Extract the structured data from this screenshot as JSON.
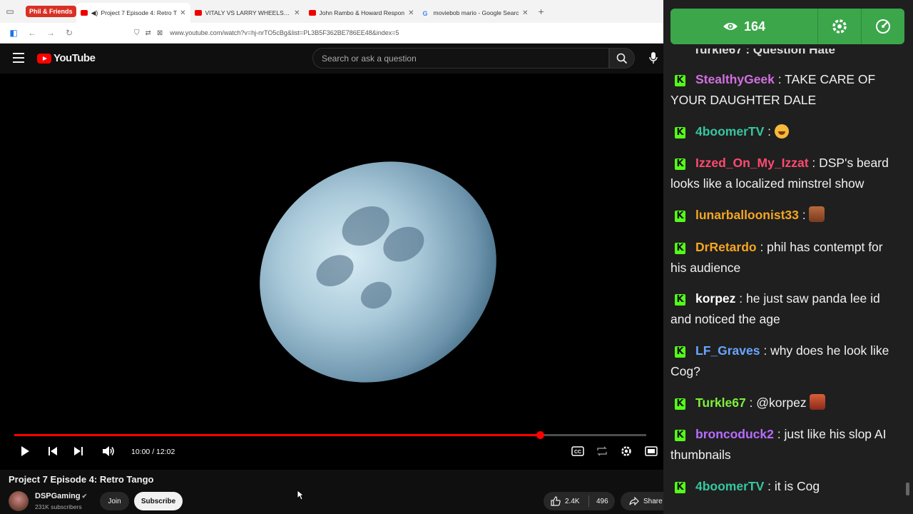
{
  "browser": {
    "tab_group": "Phil & Friends",
    "tabs": [
      {
        "title": "Project 7 Episode 4: Retro T",
        "active": true,
        "audio": true
      },
      {
        "title": "VITALY VS LARRY WHEELS (FULL"
      },
      {
        "title": "John Rambo & Howard Respon"
      },
      {
        "title": "moviebob mario - Google Searc"
      }
    ],
    "url": "www.youtube.com/watch?v=hj-nrTO5cBg&list=PL3B5F362BE786EE48&index=5"
  },
  "youtube": {
    "logo_text": "YouTube",
    "search_placeholder": "Search or ask a question",
    "player": {
      "time": "10:00 / 12:02",
      "progress": 0.8315
    },
    "video_title": "Project 7 Episode 4: Retro Tango",
    "channel": {
      "name": "DSPGaming",
      "subscribers": "231K subscribers",
      "join_label": "Join",
      "subscribe_label": "Subscribe"
    },
    "likes": "2.4K",
    "dislike_count": "496",
    "share_label": "Share"
  },
  "chat": {
    "viewer_count": "164",
    "partial_top": "Turkle67 : Question Hate",
    "messages": [
      {
        "user": "StealthyGeek",
        "color": "#d070e0",
        "text": "TAKE CARE OF YOUR DAUGHTER DALE"
      },
      {
        "user": "4boomerTV",
        "color": "#35c7a0",
        "text": "",
        "emote": "grin-emoji"
      },
      {
        "user": "Izzed_On_My_Izzat",
        "color": "#ff4a6e",
        "text": "DSP's beard looks like a localized minstrel show"
      },
      {
        "user": "lunarballoonist33",
        "color": "#f5a623",
        "text": "",
        "emote": "face-emote"
      },
      {
        "user": "DrRetardo",
        "color": "#f5a623",
        "text": "phil has contempt for his audience"
      },
      {
        "user": "korpez",
        "color": "#ffffff",
        "text": "he just saw panda lee id and noticed the age"
      },
      {
        "user": "LF_Graves",
        "color": "#6aa6ff",
        "text": "why does he look like Cog?"
      },
      {
        "user": "Turkle67",
        "color": "#7ef03a",
        "text": "@korpez",
        "emote": "face-emote"
      },
      {
        "user": "broncoduck2",
        "color": "#b86cff",
        "text": "just like his slop AI thumbnails"
      },
      {
        "user": "4boomerTV",
        "color": "#35c7a0",
        "text": "it is Cog"
      }
    ]
  }
}
